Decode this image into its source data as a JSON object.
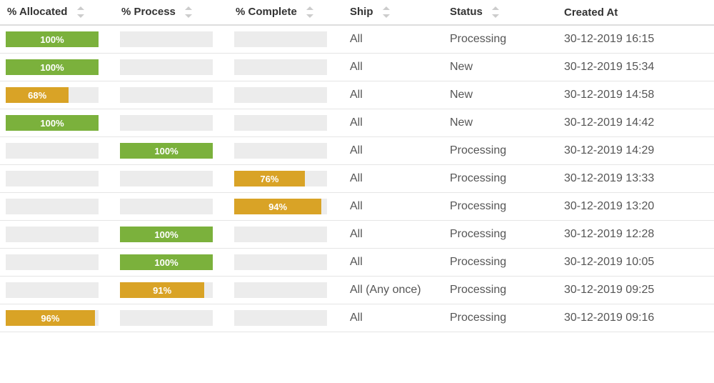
{
  "columns": {
    "allocated": "% Allocated",
    "process": "% Process",
    "complete": "% Complete",
    "ship": "Ship",
    "status": "Status",
    "created": "Created At"
  },
  "colors": {
    "green": "#7bb13c",
    "orange": "#d9a326",
    "barBg": "#ececec"
  },
  "rows": [
    {
      "allocated": 100,
      "process": null,
      "complete": null,
      "ship": "All",
      "status": "Processing",
      "created": "30-12-2019 16:15"
    },
    {
      "allocated": 100,
      "process": null,
      "complete": null,
      "ship": "All",
      "status": "New",
      "created": "30-12-2019 15:34"
    },
    {
      "allocated": 68,
      "process": null,
      "complete": null,
      "ship": "All",
      "status": "New",
      "created": "30-12-2019 14:58"
    },
    {
      "allocated": 100,
      "process": null,
      "complete": null,
      "ship": "All",
      "status": "New",
      "created": "30-12-2019 14:42"
    },
    {
      "allocated": null,
      "process": 100,
      "complete": null,
      "ship": "All",
      "status": "Processing",
      "created": "30-12-2019 14:29"
    },
    {
      "allocated": null,
      "process": null,
      "complete": 76,
      "ship": "All",
      "status": "Processing",
      "created": "30-12-2019 13:33"
    },
    {
      "allocated": null,
      "process": null,
      "complete": 94,
      "ship": "All",
      "status": "Processing",
      "created": "30-12-2019 13:20"
    },
    {
      "allocated": null,
      "process": 100,
      "complete": null,
      "ship": "All",
      "status": "Processing",
      "created": "30-12-2019 12:28"
    },
    {
      "allocated": null,
      "process": 100,
      "complete": null,
      "ship": "All",
      "status": "Processing",
      "created": "30-12-2019 10:05"
    },
    {
      "allocated": null,
      "process": 91,
      "complete": null,
      "ship": "All (Any once)",
      "status": "Processing",
      "created": "30-12-2019 09:25"
    },
    {
      "allocated": 96,
      "process": null,
      "complete": null,
      "ship": "All",
      "status": "Processing",
      "created": "30-12-2019 09:16"
    }
  ]
}
